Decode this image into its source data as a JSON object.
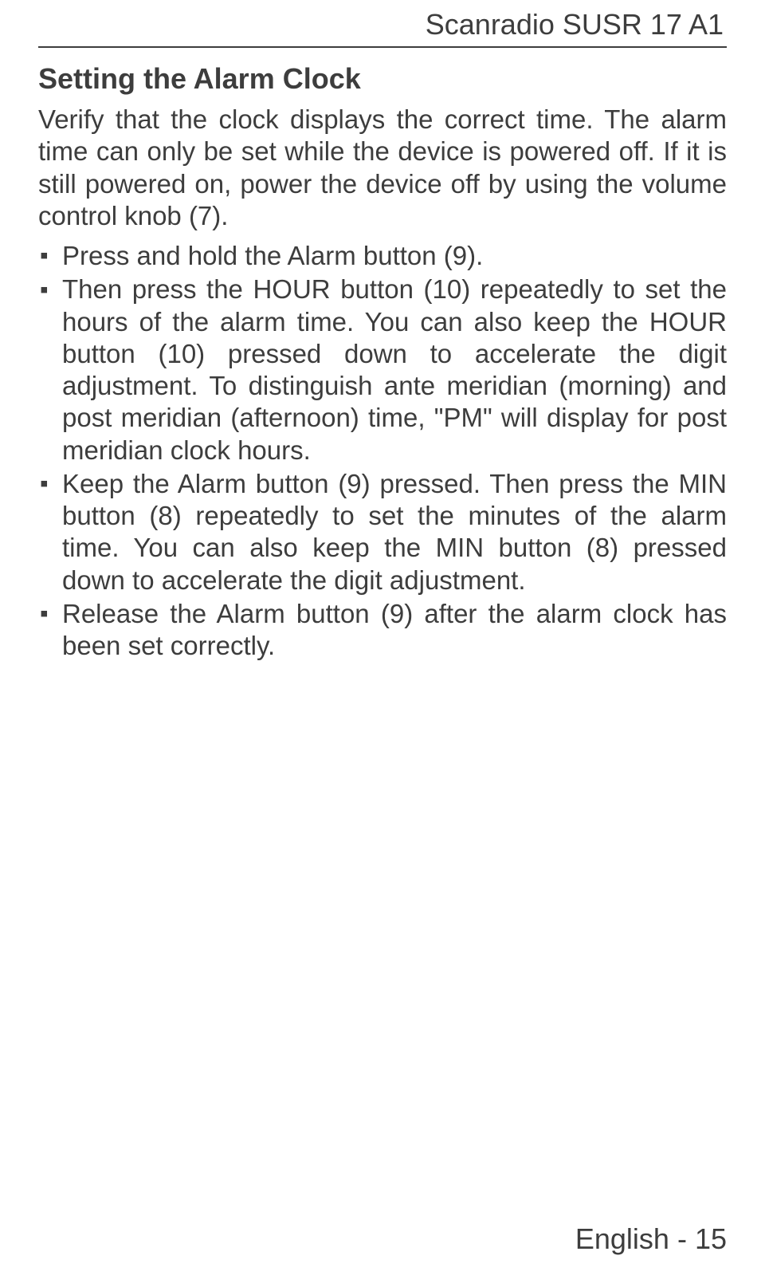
{
  "header": {
    "product_title": "Scanradio SUSR 17 A1"
  },
  "section": {
    "title": "Setting the Alarm Clock",
    "intro": "Verify that the clock displays the correct time. The alarm time can only be set while the device is powered off. If it is still powered on, power the device off by using the volume control knob (7).",
    "bullets": [
      "Press and hold the Alarm button (9).",
      "Then press the HOUR button (10) repeatedly to set the hours of the alarm time. You can also keep the HOUR button (10) pressed down to accelerate the digit adjustment. To distinguish ante meridian (morning) and post meridian (afternoon) time, \"PM\" will display for post meridian clock hours.",
      "Keep the Alarm button (9) pressed. Then press the MIN button (8) repeatedly to set the minutes of the alarm time. You can also keep the MIN button (8) pressed down to accelerate the digit adjustment.",
      "Release the Alarm button (9) after the alarm clock has been set correctly."
    ]
  },
  "footer": {
    "language": "English",
    "separator": " - ",
    "page_number": "15"
  }
}
